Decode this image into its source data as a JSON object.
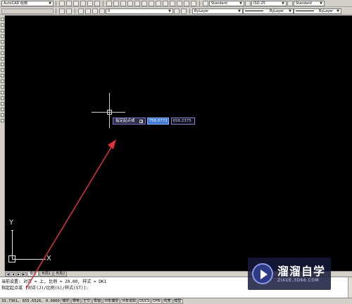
{
  "toolbar1": {
    "workspace_combo": "AutoCAD 经典",
    "text_style_combo": "Standard",
    "dim_style_combo": "ISO-25",
    "table_style_combo": "Standard"
  },
  "toolbar2": {
    "layer_combo": "0",
    "color_combo": "ByLayer",
    "linetype_combo": "ByLayer",
    "lineweight_combo": "ByLayer"
  },
  "dynamic_input": {
    "prompt": "指定起点或",
    "x_value": "756.0772",
    "y_value": "658.2375"
  },
  "ucs": {
    "y_label": "Y",
    "x_label": "X"
  },
  "layout_tabs": {
    "nav": [
      "|◀",
      "◀",
      "▶",
      "▶|"
    ],
    "tabs": [
      "模型",
      "布局1",
      "布局2"
    ],
    "active_index": 0
  },
  "command": {
    "line1": "当前设置: 对正 = 上, 比例 = 20.00, 样式 = DK1",
    "line2": "指定起点或 [对正(J)/比例(S)/样式(ST)]:",
    "line3": ""
  },
  "status": {
    "coords": "33.7361, 655.6526, 0.0000",
    "buttons": [
      "捕捉",
      "栅格",
      "正交",
      "极轴",
      "对象捕捉",
      "对象追踪",
      "DUCS",
      "DYN",
      "线宽",
      "模型"
    ]
  },
  "watermark": {
    "title": "溜溜自学",
    "url": "ZIXUE.3D66.COM"
  },
  "colors": {
    "canvas": "#000000",
    "annotation_arrow": "#e0303a",
    "dyn_active_field": "#3c78d8"
  }
}
